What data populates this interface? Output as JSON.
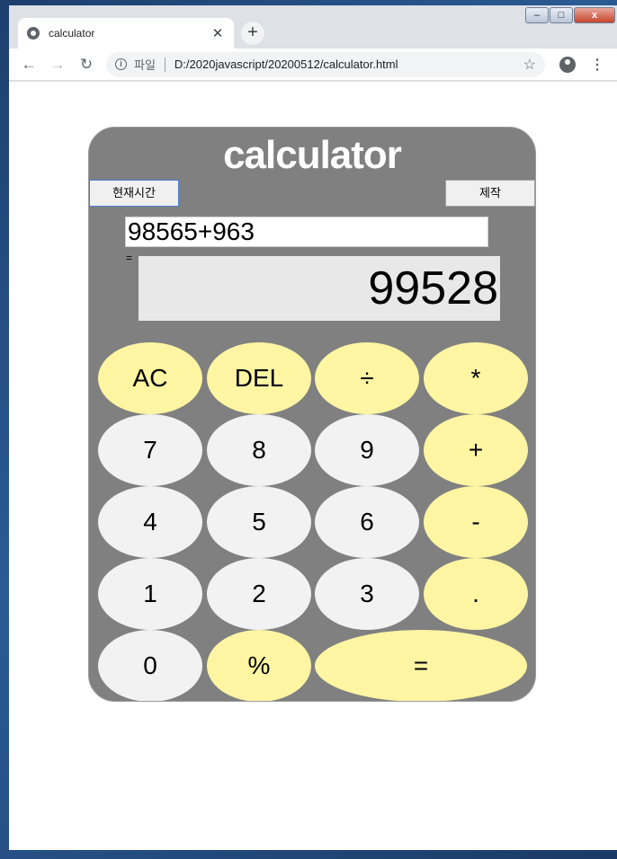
{
  "browser": {
    "tab_title": "calculator",
    "tab_close": "✕",
    "new_tab": "+",
    "scheme_label": "파일",
    "url": "D:/2020javascript/20200512/calculator.html",
    "win_controls": {
      "minimize": "–",
      "maximize": "□",
      "close": "x"
    },
    "nav": {
      "back": "←",
      "forward": "→",
      "reload": "↻",
      "star": "☆",
      "menu": "⋮",
      "info": "i"
    }
  },
  "calculator": {
    "title": "calculator",
    "time_button": "현재시간",
    "credits_button": "제작",
    "expression": "98565+963",
    "equals_label": "=",
    "result": "99528",
    "keys": {
      "ac": "AC",
      "del": "DEL",
      "divide": "÷",
      "multiply": "*",
      "seven": "7",
      "eight": "8",
      "nine": "9",
      "plus": "+",
      "four": "4",
      "five": "5",
      "six": "6",
      "minus": "-",
      "one": "1",
      "two": "2",
      "three": "3",
      "dot": ".",
      "zero": "0",
      "percent": "%",
      "equals": "="
    }
  },
  "colors": {
    "calc_body": "#808080",
    "number_key": "#f2f2f2",
    "operator_key": "#fff5a3",
    "result_bg": "#e8e8e8"
  }
}
